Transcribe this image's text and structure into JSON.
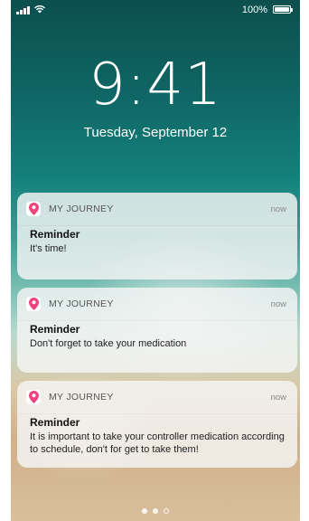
{
  "status_bar": {
    "battery": "100%"
  },
  "lock": {
    "time": "9:41",
    "date": "Tuesday, September 12"
  },
  "notifications": [
    {
      "app": "MY JOURNEY",
      "time": "now",
      "title": "Reminder",
      "message": "It's time!"
    },
    {
      "app": "MY JOURNEY",
      "time": "now",
      "title": "Reminder",
      "message": "Don't forget to take your medication"
    },
    {
      "app": "MY JOURNEY",
      "time": "now",
      "title": "Reminder",
      "message": "It is important to take your controller medication according to schedule, don't for get to take them!"
    }
  ],
  "colors": {
    "app_icon": "#f0437e"
  },
  "icons": {
    "app": "location-pin-icon"
  }
}
